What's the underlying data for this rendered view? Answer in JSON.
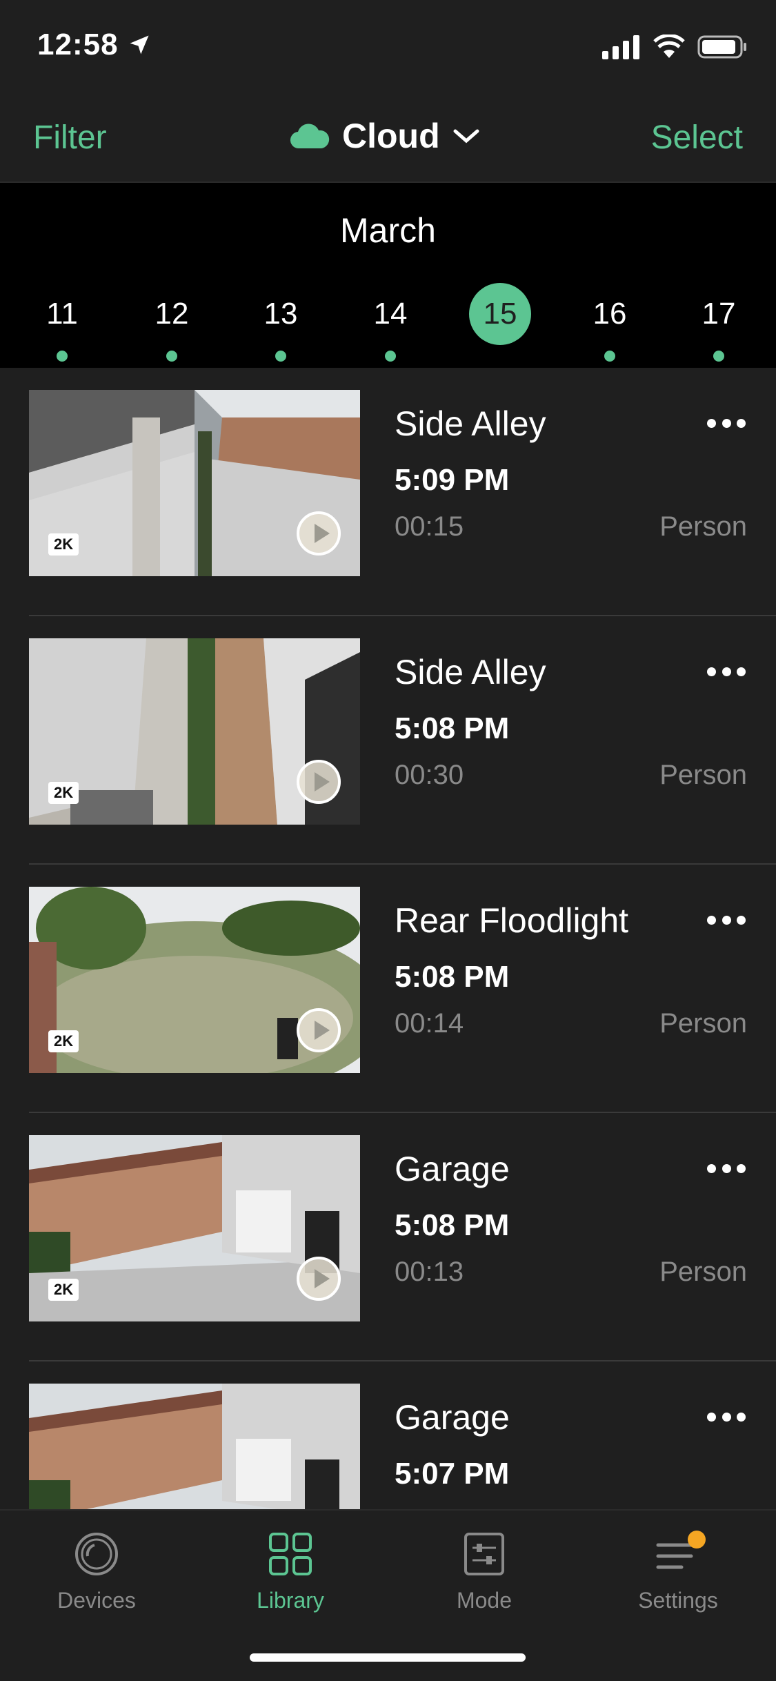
{
  "status": {
    "time": "12:58"
  },
  "nav": {
    "filter": "Filter",
    "storage": "Cloud",
    "select": "Select"
  },
  "dates": {
    "month": "March",
    "days": [
      "11",
      "12",
      "13",
      "14",
      "15",
      "16",
      "17"
    ],
    "selected": "15"
  },
  "recordings": [
    {
      "camera": "Side Alley",
      "time": "5:09 PM",
      "duration": "00:15",
      "tag": "Person",
      "quality": "2K"
    },
    {
      "camera": "Side Alley",
      "time": "5:08 PM",
      "duration": "00:30",
      "tag": "Person",
      "quality": "2K"
    },
    {
      "camera": "Rear Floodlight",
      "time": "5:08 PM",
      "duration": "00:14",
      "tag": "Person",
      "quality": "2K"
    },
    {
      "camera": "Garage",
      "time": "5:08 PM",
      "duration": "00:13",
      "tag": "Person",
      "quality": "2K"
    },
    {
      "camera": "Garage",
      "time": "5:07 PM",
      "duration": "",
      "tag": "",
      "quality": ""
    }
  ],
  "tabs": [
    {
      "label": "Devices",
      "icon": "devices-icon"
    },
    {
      "label": "Library",
      "icon": "library-icon"
    },
    {
      "label": "Mode",
      "icon": "mode-icon"
    },
    {
      "label": "Settings",
      "icon": "settings-icon"
    }
  ],
  "colors": {
    "accent": "#5cc592",
    "notification": "#f5a623",
    "background": "#1f1f1f"
  }
}
